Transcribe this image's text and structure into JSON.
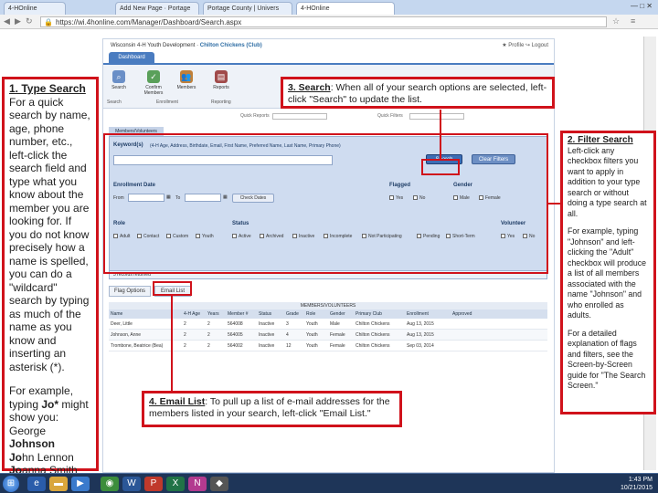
{
  "browser": {
    "tabs": [
      "4-HOnline",
      "Add New Page · Portage",
      "Portage County | Univers",
      "4-HOnline"
    ],
    "active_tab": 3,
    "url": "https://wi.4honline.com/Manager/Dashboard/Search.aspx",
    "window_controls": "— □ ✕"
  },
  "app": {
    "org": "Wisconsin 4-H Youth Development",
    "club": "Chilton Chickens (Club)",
    "top_links": "★ Profile  ↪ Logout",
    "dashboard_tab": "Dashboard",
    "ribbon": {
      "buttons": [
        {
          "label": "Search",
          "icon": "magnifier-icon"
        },
        {
          "label": "Confirm Members",
          "icon": "confirm-icon"
        },
        {
          "label": "Members",
          "icon": "members-icon"
        },
        {
          "label": "Reports",
          "icon": "reports-icon"
        }
      ],
      "groups": [
        "Search",
        "Enrollment",
        "Reporting"
      ]
    },
    "filter_row": {
      "label1": "Quick Reports",
      "label2": "Quick Filters"
    },
    "members_tab": "Members/Volunteers",
    "keyword_label": "Keyword(s)",
    "keyword_hint": "(4-H Age, Address, Birthdate, Email, First Name, Preferred Name, Last Name, Primary Phone)",
    "search_button": "Search",
    "clear_filters_button": "Clear Filters",
    "enrollment_date": {
      "label": "Enrollment Date",
      "from": "From",
      "to": "To",
      "check_dates": "Check Dates"
    },
    "flagged": {
      "label": "Flagged",
      "options": [
        "Yes",
        "No"
      ]
    },
    "gender": {
      "label": "Gender",
      "options": [
        "Male",
        "Female"
      ]
    },
    "role": {
      "label": "Role",
      "options": [
        "Adult",
        "Contact",
        "Custom",
        "Youth"
      ]
    },
    "status": {
      "label": "Status",
      "options": [
        "Active",
        "Archived",
        "Inactive",
        "Incomplete",
        "Not Participating",
        "Pending",
        "Short-Term"
      ]
    },
    "volunteer": {
      "label": "Volunteer",
      "options": [
        "Yes",
        "No"
      ]
    },
    "records_returned": "3 records returned",
    "flag_options_button": "Flag Options",
    "email_list_button": "Email List",
    "table": {
      "title": "MEMBERS/VOLUNTEERS",
      "headers": [
        "Name",
        "4-H Age",
        "Years",
        "Member #",
        "Status",
        "Grade",
        "Role",
        "Gender",
        "Primary Club",
        "Enrollment",
        "Approved"
      ],
      "rows": [
        [
          "Deer, Little",
          "2",
          "2",
          "564008",
          "Inactive",
          "3",
          "Youth",
          "Male",
          "Chilton Chickens",
          "Aug 13, 2015",
          ""
        ],
        [
          "Johnson, Anne",
          "2",
          "2",
          "564005",
          "Inactive",
          "4",
          "Youth",
          "Female",
          "Chilton Chickens",
          "Aug 13, 2015",
          ""
        ],
        [
          "Trombone, Beatrice (Bea)",
          "2",
          "2",
          "564002",
          "Inactive",
          "12",
          "Youth",
          "Female",
          "Chilton Chickens",
          "Sep 03, 2014",
          ""
        ]
      ]
    }
  },
  "callouts": {
    "type_search": {
      "title": "1. Type Search",
      "p1": "For a quick search by name, age, phone number, etc., left-click the search field and type what you know about the member you are looking for. If you do not know precisely how a name is spelled, you can do a \"wildcard\" search by typing as much of the name as you know and inserting an asterisk (*).",
      "p2_prefix": "For example, typing ",
      "p2_bold": "Jo*",
      "p2_suffix": " might show you:",
      "names": [
        {
          "bold": "George ",
          "rest": "Johnson"
        },
        {
          "bold": "Jo",
          "rest": "hn Lennon"
        },
        {
          "bold": "Jo",
          "rest": "anna Smith"
        }
      ]
    },
    "filter_search": {
      "title": "2. Filter Search",
      "p1": "Left-click any checkbox filters you want to apply in addition to your type search or without doing a type search at all.",
      "p2": "For example, typing \"Johnson\" and left-clicking the \"Adult\" checkbox will produce a list of all members associated with the name \"Johnson\" and who enrolled as adults.",
      "p3": "For a detailed explanation of flags and filters, see the Screen-by-Screen guide for \"The Search Screen.\""
    },
    "search": {
      "title": "3. Search",
      "text": ": When all of your search options are selected, left-click \"Search\" to update the list."
    },
    "email_list": {
      "title": "4. Email List",
      "text": ": To pull up a list of e-mail addresses for the members listed in your search, left-click \"Email List.\""
    }
  },
  "taskbar": {
    "time": "1:43 PM",
    "date": "10/21/2015"
  },
  "colors": {
    "callout_red": "#d0121b",
    "accent_blue": "#4a7cc0",
    "taskbar": "#1e3558"
  }
}
